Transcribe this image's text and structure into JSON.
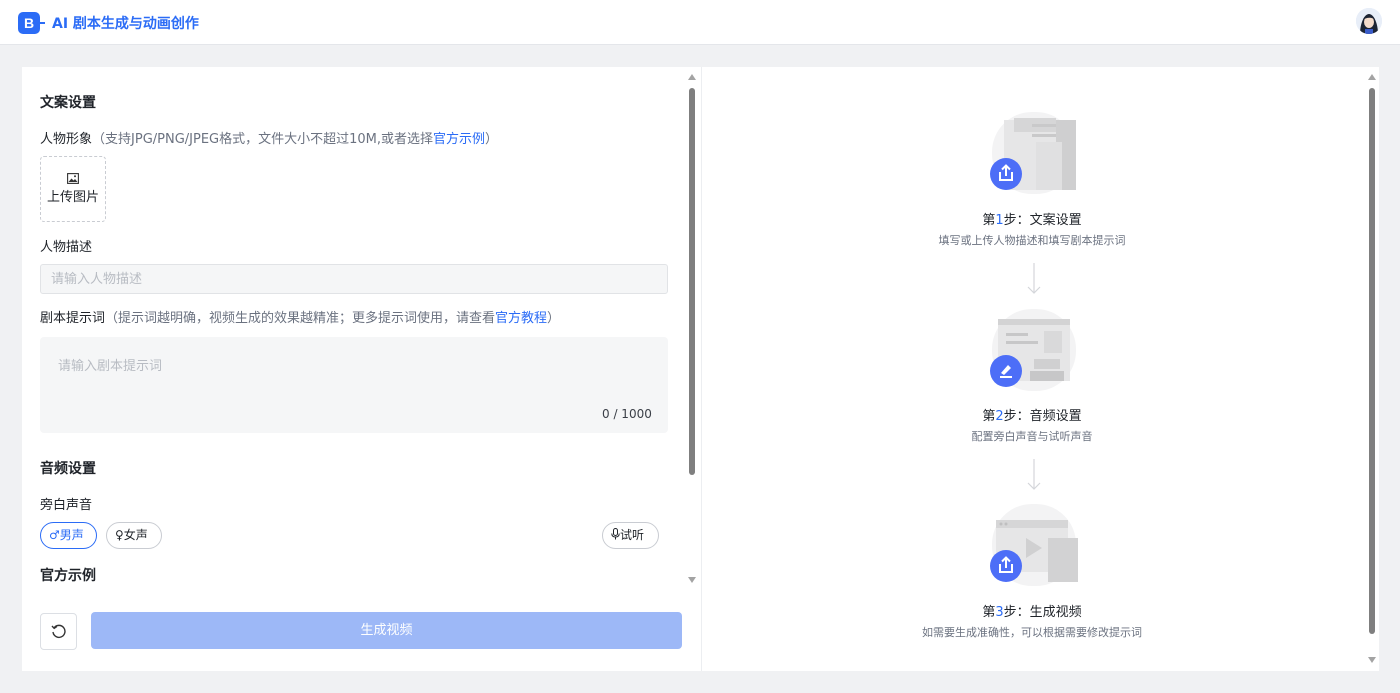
{
  "app": {
    "title": "AI 剧本生成与动画创作",
    "logo_letter": "B"
  },
  "copy_settings": {
    "section_title": "文案设置",
    "character_image": {
      "label": "人物形象",
      "hint_prefix": "（支持JPG/PNG/JPEG格式，文件大小不超过10M,或者选择",
      "hint_link": "官方示例",
      "hint_suffix": "）",
      "upload_label": "上传图片"
    },
    "character_desc": {
      "label": "人物描述",
      "placeholder": "请输入人物描述",
      "value": ""
    },
    "script_prompt": {
      "label": "剧本提示词",
      "hint_prefix": "（提示词越明确，视频生成的效果越精准；更多提示词使用，请查看",
      "hint_link": "官方教程",
      "hint_suffix": "）",
      "placeholder": "请输入剧本提示词",
      "value": "",
      "counter": "0 / 1000"
    }
  },
  "audio_settings": {
    "section_title": "音频设置",
    "narration_label": "旁白声音",
    "voices": [
      {
        "label": "男声",
        "icon": "male-icon",
        "selected": true
      },
      {
        "label": "女声",
        "icon": "female-icon",
        "selected": false
      }
    ],
    "preview_label": "试听"
  },
  "official_examples": {
    "section_title": "官方示例"
  },
  "actions": {
    "generate_label": "生成视频"
  },
  "steps": [
    {
      "prefix": "第",
      "num": "1",
      "suffix": "步：文案设置",
      "desc": "填写或上传人物描述和填写剧本提示词",
      "badge_icon": "upload-icon"
    },
    {
      "prefix": "第",
      "num": "2",
      "suffix": "步：音频设置",
      "desc": "配置旁白声音与试听声音",
      "badge_icon": "edit-icon"
    },
    {
      "prefix": "第",
      "num": "3",
      "suffix": "步：生成视频",
      "desc": "如需要生成准确性，可以根据需要修改提示词",
      "badge_icon": "upload-icon"
    }
  ],
  "colors": {
    "accent": "#2b6cf6",
    "generate_disabled": "#9db8f7",
    "badge_gradient_start": "#6b8cff",
    "badge_gradient_end": "#3f5ef6"
  }
}
